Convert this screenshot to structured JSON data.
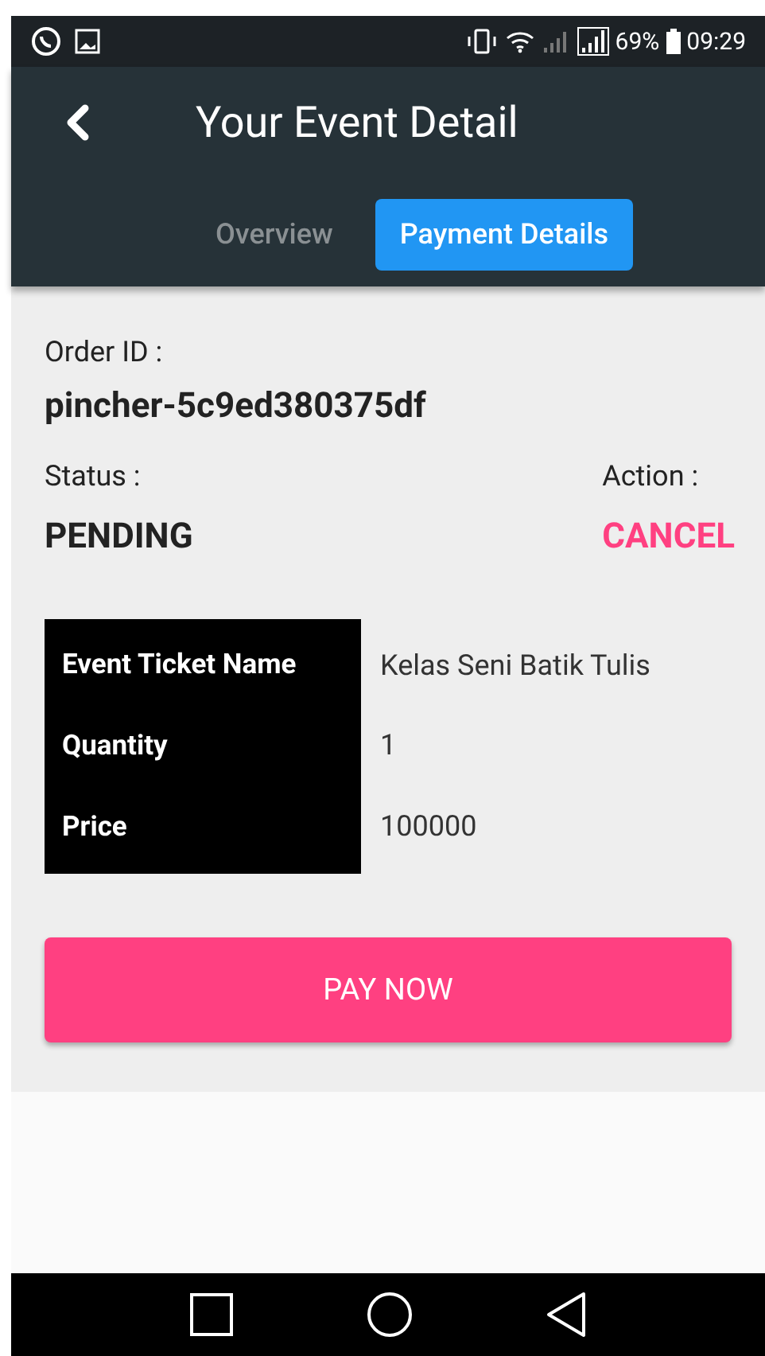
{
  "status_bar": {
    "battery": "69%",
    "time": "09:29"
  },
  "app_bar": {
    "title": "Your Event Detail"
  },
  "tabs": [
    {
      "label": "Overview",
      "selected": false
    },
    {
      "label": "Payment Details",
      "selected": true
    }
  ],
  "order": {
    "label": "Order ID :",
    "value": "pincher-5c9ed380375df"
  },
  "status": {
    "label": "Status :",
    "value": "PENDING"
  },
  "action": {
    "label": "Action :",
    "value": "CANCEL"
  },
  "details": [
    {
      "label": "Event Ticket Name",
      "value": "Kelas Seni Batik Tulis"
    },
    {
      "label": "Quantity",
      "value": "1"
    },
    {
      "label": "Price",
      "value": "100000"
    }
  ],
  "pay_button": "PAY NOW"
}
